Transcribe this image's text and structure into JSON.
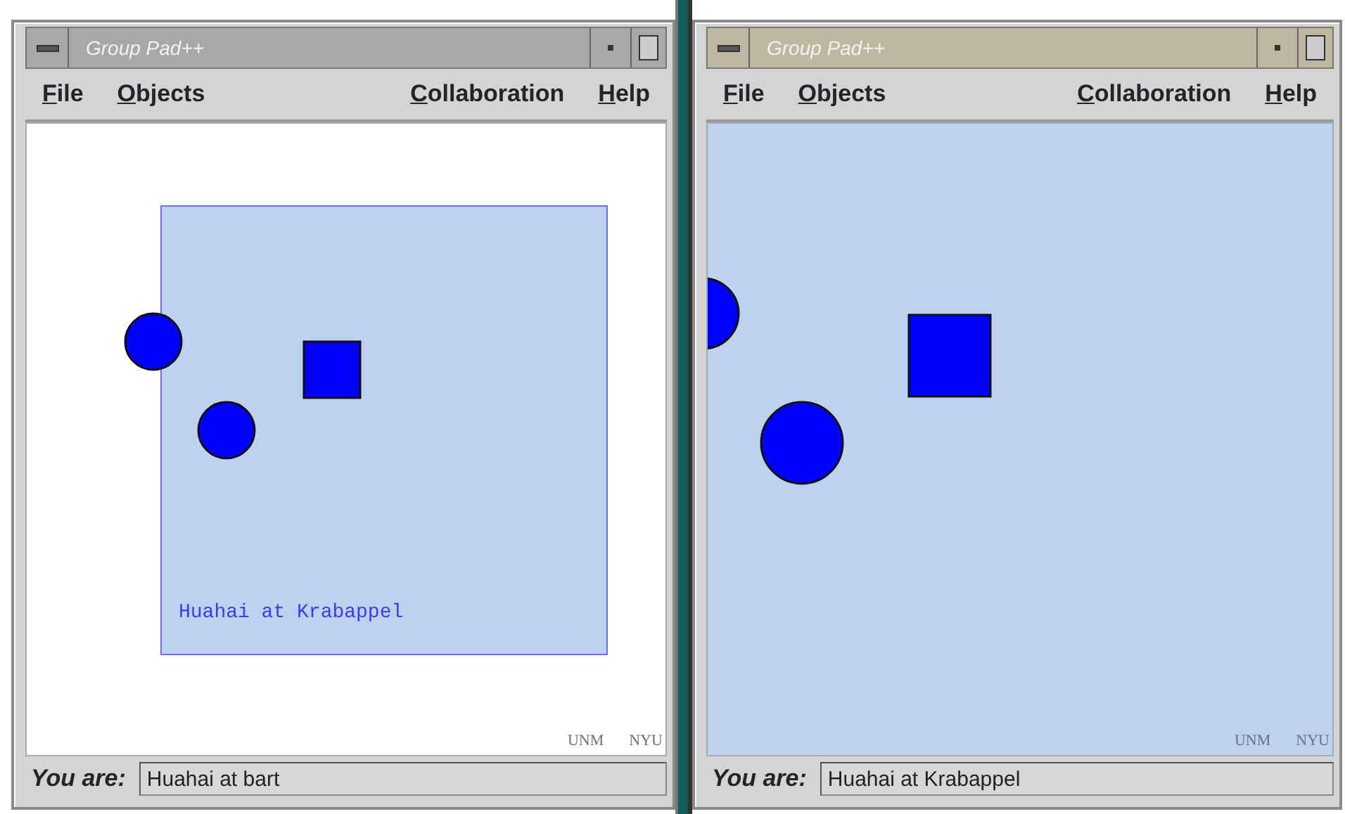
{
  "windows": [
    {
      "title": "Group Pad++",
      "menu": [
        "File",
        "Objects",
        "Collaboration",
        "Help"
      ],
      "remote_view": {
        "label": "Huahai at Krabappel"
      },
      "shapes": [
        {
          "kind": "circle"
        },
        {
          "kind": "circle"
        },
        {
          "kind": "square"
        }
      ],
      "corner_labels": [
        "UNM",
        "NYU"
      ],
      "user_label": "You are:",
      "user_value": "Huahai at bart"
    },
    {
      "title": "Group Pad++",
      "menu": [
        "File",
        "Objects",
        "Collaboration",
        "Help"
      ],
      "shapes": [
        {
          "kind": "circle"
        },
        {
          "kind": "circle"
        },
        {
          "kind": "square"
        }
      ],
      "corner_labels": [
        "UNM",
        "NYU"
      ],
      "user_label": "You are:",
      "user_value": "Huahai at Krabappel"
    }
  ]
}
